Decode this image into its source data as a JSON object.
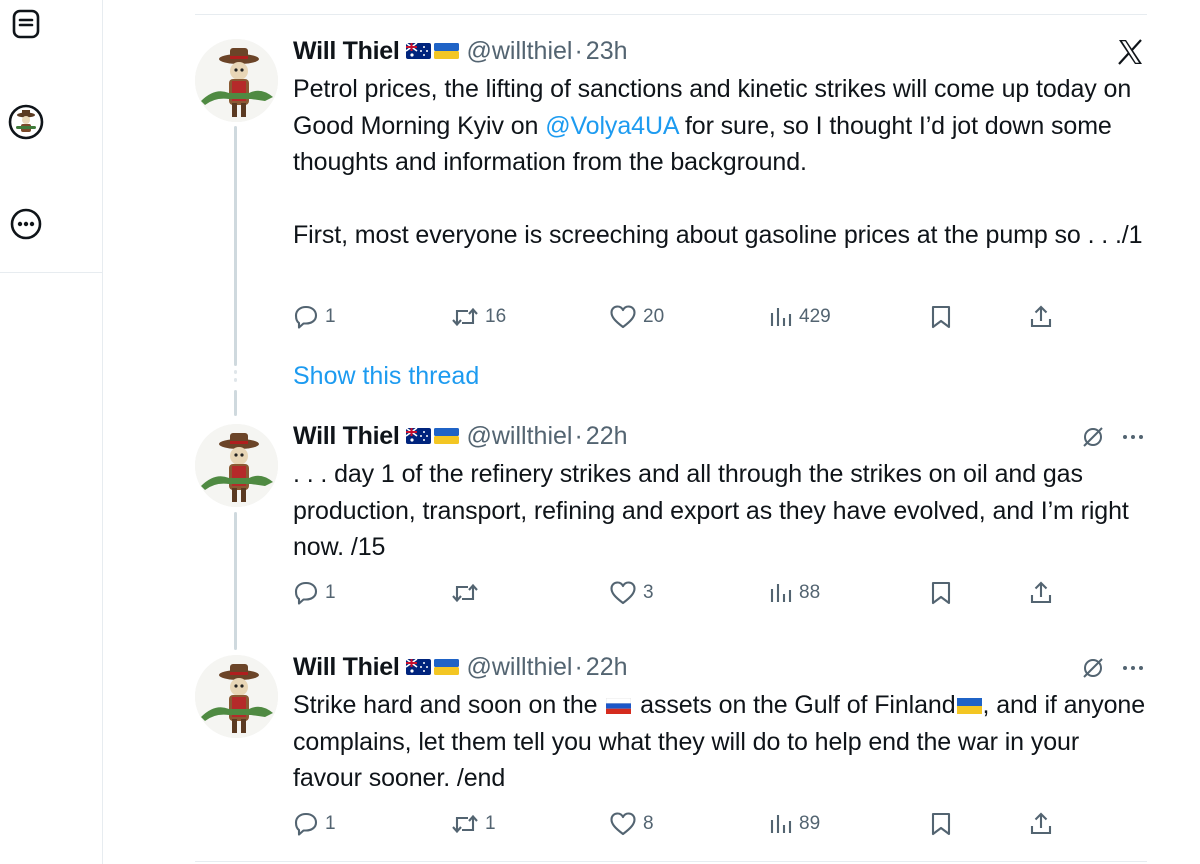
{
  "sidebar": {
    "icons": [
      "article-icon",
      "profile-avatar",
      "more-circle-icon"
    ]
  },
  "colors": {
    "accent": "#1d9bf0",
    "muted": "#536471",
    "text": "#0f1419",
    "divider": "#e7ecf0"
  },
  "show_thread_label": "Show this thread",
  "tweets": [
    {
      "name": "Will Thiel",
      "handle": "@willthiel",
      "separator": "·",
      "time": "23h",
      "text_before_mention": "Petrol prices, the lifting of sanctions and kinetic strikes will come up today on Good Morning Kyiv on ",
      "mention": "@Volya4UA",
      "text_after_mention": " for sure, so I thought I’d jot down some thoughts and information from the background.",
      "paragraph2": "First, most everyone is screeching about gasoline prices at the pump so . . ./1",
      "corner_icon": "x-logo-icon",
      "stats": {
        "replies": "1",
        "reposts": "16",
        "likes": "20",
        "views": "429"
      }
    },
    {
      "name": "Will Thiel",
      "handle": "@willthiel",
      "separator": "·",
      "time": "22h",
      "text": ". . . day 1 of the refinery strikes and all through the strikes on oil and gas production, transport, refining and export as they have evolved, and I’m right now. /15",
      "stats": {
        "replies": "1",
        "reposts": "",
        "likes": "3",
        "views": "88"
      }
    },
    {
      "name": "Will Thiel",
      "handle": "@willthiel",
      "separator": "·",
      "time": "22h",
      "text_before_flag1": "Strike hard and soon on the ",
      "text_between_flags": " assets on the Gulf of Finland",
      "text_after_flag2": ", and if anyone complains, let them tell you what they will do to help end the war in your favour sooner. /end",
      "stats": {
        "replies": "1",
        "reposts": "1",
        "likes": "8",
        "views": "89"
      }
    }
  ]
}
